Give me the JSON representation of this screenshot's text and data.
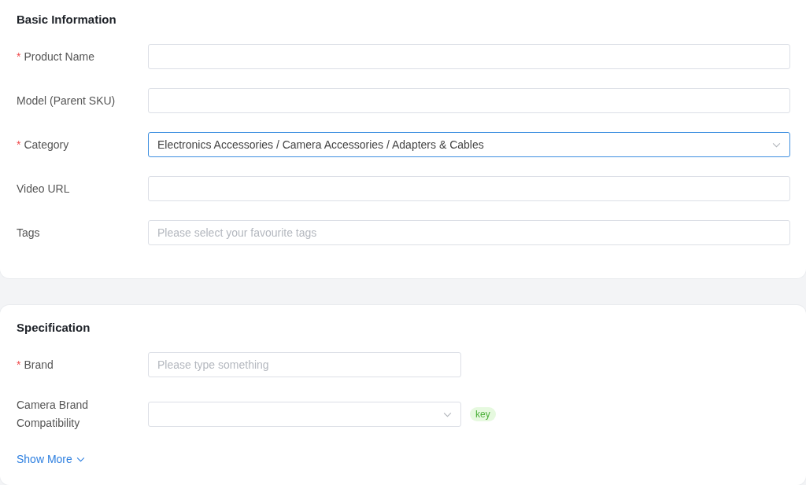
{
  "sections": [
    {
      "title": "Basic Information",
      "fields": [
        {
          "label": "Product Name",
          "required_mark": "*",
          "kind": "input",
          "wide": true,
          "focused": false
        },
        {
          "label": "Model (Parent SKU)",
          "kind": "input",
          "wide": true,
          "focused": false
        },
        {
          "label": "Category",
          "required_mark": "*",
          "kind": "select",
          "wide": true,
          "focused": true,
          "value": "Electronics Accessories / Camera Accessories / Adapters & Cables"
        },
        {
          "label": "Video URL",
          "kind": "input",
          "wide": true,
          "focused": false
        },
        {
          "label": "Tags",
          "kind": "input",
          "wide": true,
          "focused": false,
          "placeholder": "Please select your favourite tags"
        }
      ]
    },
    {
      "title": "Specification",
      "fields": [
        {
          "label": "Brand",
          "required_mark": "*",
          "kind": "input",
          "wide": false,
          "focused": false,
          "placeholder": "Please type something"
        },
        {
          "label": "Camera Brand Compatibility",
          "kind": "select",
          "wide": false,
          "focused": false,
          "badge": "key"
        }
      ],
      "show_more": "Show More"
    }
  ]
}
